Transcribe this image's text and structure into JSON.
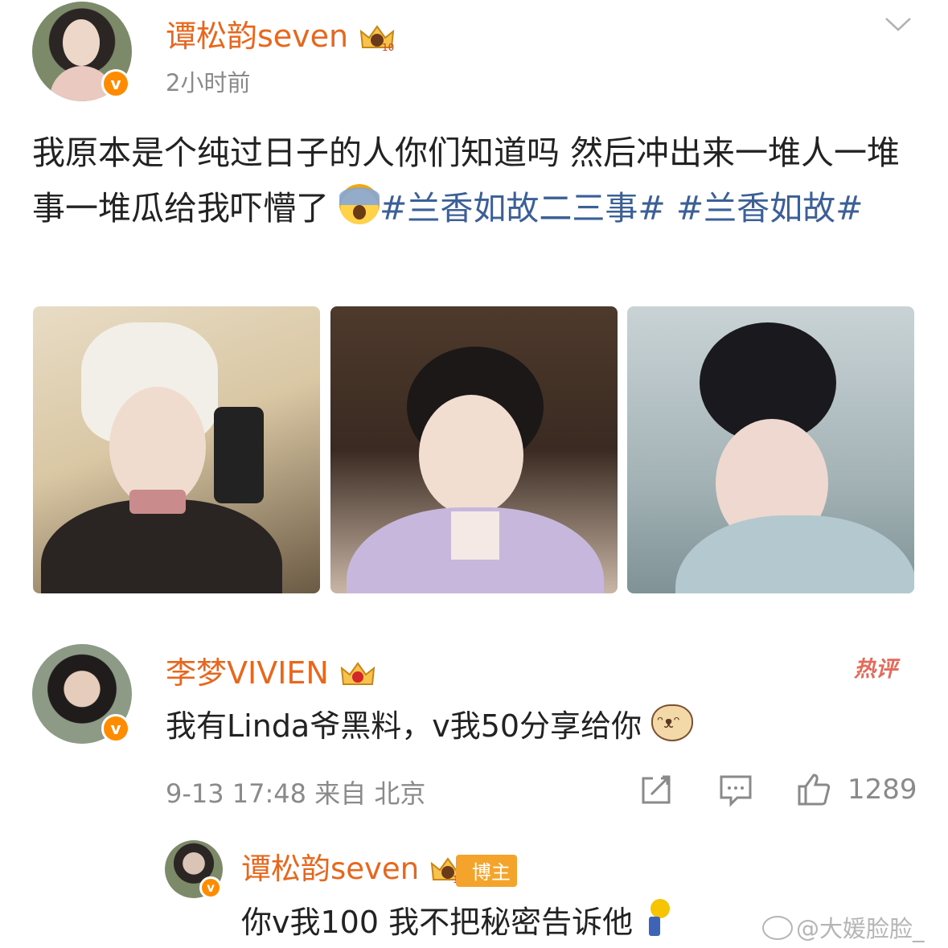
{
  "post": {
    "author": "谭松韵seven",
    "time": "2小时前",
    "text_plain": "我原本是个纯过日子的人你们知道吗 然后冲出来一堆人一堆事一堆瓜给我吓懵了",
    "emoji": "scream-emoji",
    "hashtag1": "#兰香如故二三事#",
    "hashtag2": "#兰香如故#",
    "images": [
      "photo-1",
      "photo-2",
      "photo-3"
    ]
  },
  "comment": {
    "author": "李梦VIVIEN",
    "hot_label": "热评",
    "text": "我有Linda爷黑料，v我50分享给你",
    "emoji": "cat-emoji",
    "meta": "9-13 17:48 来自 北京",
    "likes": "1289"
  },
  "reply": {
    "author": "谭松韵seven",
    "host_badge": "博主",
    "text": "你v我100 我不把秘密告诉他",
    "emoji": "running-emoji"
  },
  "watermark": "@大媛脸脸_",
  "colors": {
    "username": "#e8671c",
    "hashtag": "#3b5f97",
    "meta": "#8a8a8a",
    "verified": "#ff8c00",
    "hot": "#e46a5a"
  }
}
